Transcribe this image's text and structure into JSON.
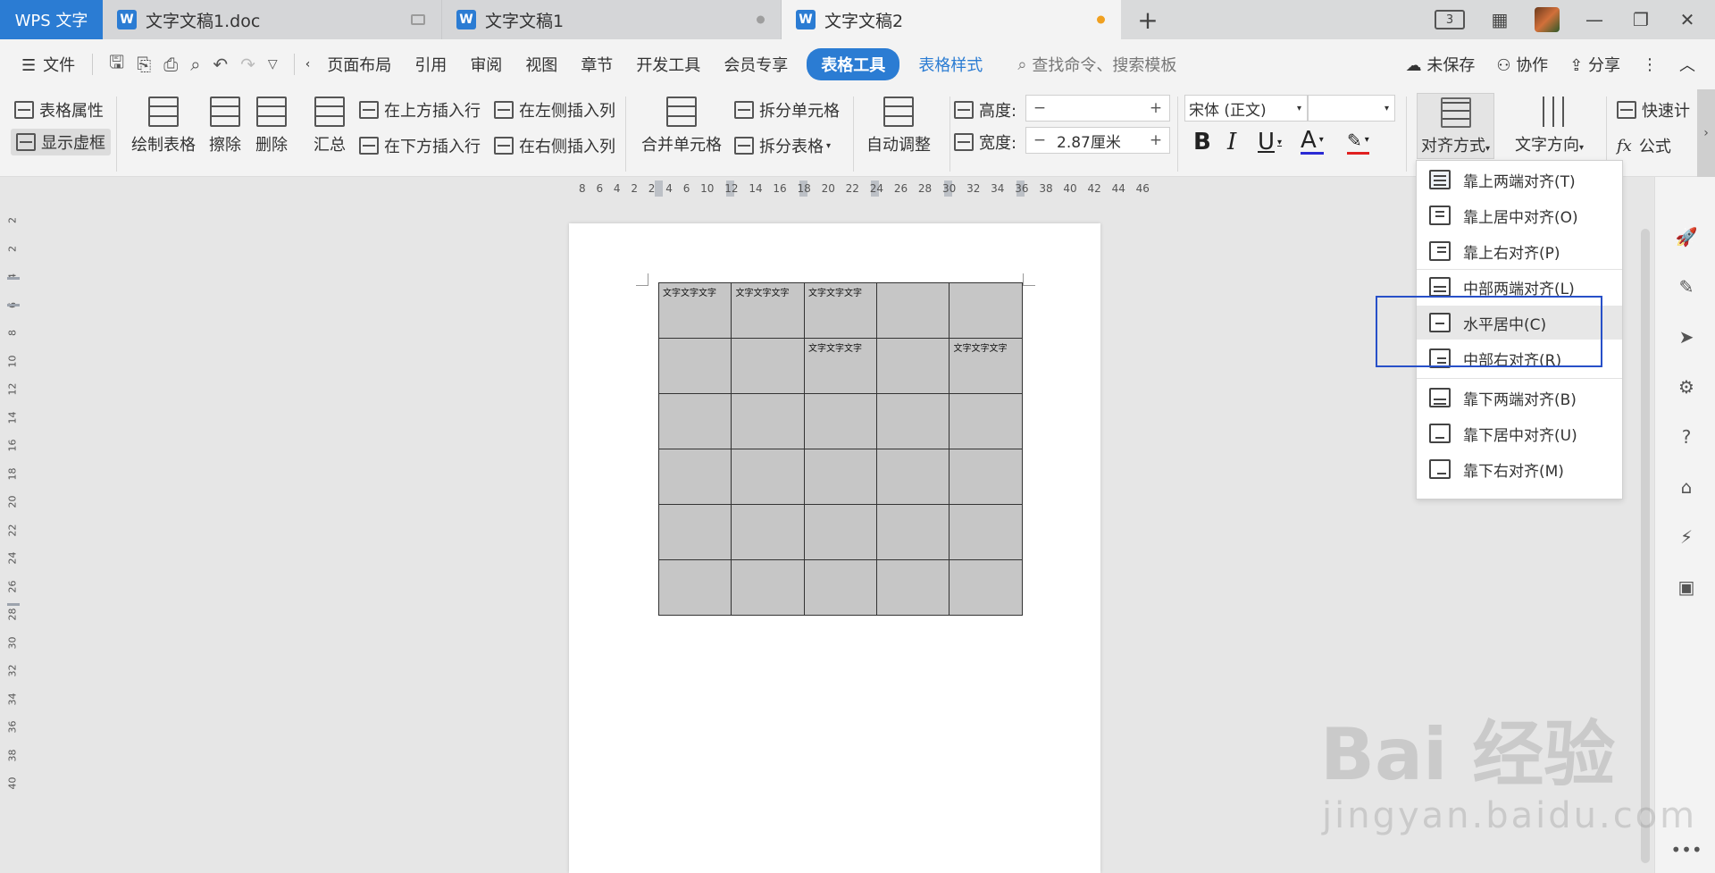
{
  "tabs": {
    "app": "WPS 文字",
    "docs": [
      {
        "label": "文字文稿1.doc",
        "tail": "monitor"
      },
      {
        "label": "文字文稿1",
        "tail": "dot"
      },
      {
        "label": "文字文稿2",
        "tail": "dot-orange"
      }
    ],
    "badge": "3"
  },
  "menu": {
    "file": "文件",
    "items": [
      "页面布局",
      "引用",
      "审阅",
      "视图",
      "章节",
      "开发工具",
      "会员专享"
    ],
    "active": "表格工具",
    "style": "表格样式",
    "search_placeholder": "查找命令、搜索模板",
    "unsaved": "未保存",
    "collab": "协作",
    "share": "分享"
  },
  "ribbon": {
    "table_props": "表格属性",
    "show_grid": "显示虚框",
    "draw_table": "绘制表格",
    "erase": "擦除",
    "delete": "删除",
    "summary": "汇总",
    "insert_above": "在上方插入行",
    "insert_below": "在下方插入行",
    "insert_left": "在左侧插入列",
    "insert_right": "在右侧插入列",
    "merge_cells": "合并单元格",
    "split_cells": "拆分单元格",
    "split_table": "拆分表格",
    "auto_adjust": "自动调整",
    "height_label": "高度:",
    "height_value": "",
    "width_label": "宽度:",
    "width_value": "2.87厘米",
    "font_name": "宋体 (正文)",
    "font_size": "",
    "align": "对齐方式",
    "text_dir": "文字方向",
    "quick_calc": "快速计",
    "formula": "公式",
    "minus": "−",
    "plus": "+"
  },
  "ruler": {
    "h_numbers": "8 6 4 2 2 4 6 10 12 14 16 18 20 22 24 26 28 30 32 34 36 38 40 42 44 46",
    "v_numbers": [
      "2",
      "2",
      "4",
      "6",
      "8",
      "10",
      "12",
      "14",
      "16",
      "18",
      "20",
      "22",
      "24",
      "26",
      "28",
      "30",
      "32",
      "34",
      "36",
      "38",
      "40"
    ]
  },
  "table": {
    "rows": [
      [
        "文字文字文字",
        "文字文字文字",
        "文字文字文字",
        "",
        ""
      ],
      [
        "",
        "",
        "文字文字文字",
        "",
        "文字文字文字"
      ],
      [
        "",
        "",
        "",
        "",
        ""
      ],
      [
        "",
        "",
        "",
        "",
        ""
      ],
      [
        "",
        "",
        "",
        "",
        ""
      ],
      [
        "",
        "",
        "",
        "",
        ""
      ]
    ]
  },
  "dropdown": {
    "items": [
      "靠上两端对齐(T)",
      "靠上居中对齐(O)",
      "靠上右对齐(P)",
      "中部两端对齐(L)",
      "水平居中(C)",
      "中部右对齐(R)",
      "靠下两端对齐(B)",
      "靠下居中对齐(U)",
      "靠下右对齐(M)"
    ],
    "hover_index": 4
  },
  "watermark": {
    "main": "Bai 经验",
    "sub": "jingyan.baidu.com"
  },
  "colors": {
    "accent": "#2b7cd3",
    "annotation": "#2850c8",
    "cell": "#c6c6c6"
  }
}
